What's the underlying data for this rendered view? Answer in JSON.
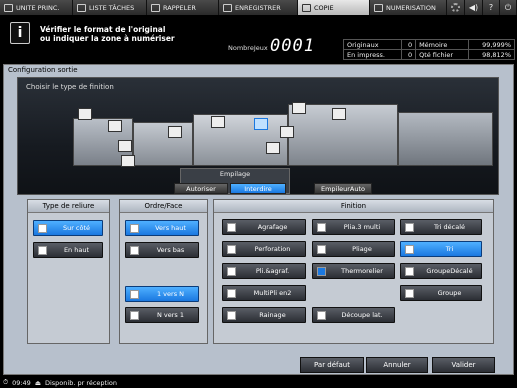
{
  "tabs": [
    {
      "label": "UNITE PRINC.",
      "icon": "home-icon"
    },
    {
      "label": "LISTE TÂCHES",
      "icon": "job-list-icon"
    },
    {
      "label": "RAPPELER",
      "icon": "recall-icon"
    },
    {
      "label": "ENREGISTRER",
      "icon": "save-icon"
    },
    {
      "label": "COPIE",
      "icon": "copy-icon"
    },
    {
      "label": "NUMERISATION",
      "icon": "scan-icon"
    }
  ],
  "message": {
    "line1": "Vérifier le format de l'original",
    "line2": "ou indiquer la zone à numériser"
  },
  "count": {
    "label": "NombreJeux",
    "value": "0001"
  },
  "counters": [
    {
      "label": "Originaux",
      "value": "0",
      "label2": "Mémoire",
      "value2": "99,999%"
    },
    {
      "label": "En impress.",
      "value": "0",
      "label2": "Qté fichier",
      "value2": "98,812%"
    }
  ],
  "panel_title": "Configuration sortie",
  "finishing_prompt": "Choisir le type de finition",
  "stacking": {
    "title": "Empilage",
    "options": [
      "Autoriser",
      "Interdire"
    ],
    "selected": "Interdire",
    "stacker_auto": "EmpileurAuto"
  },
  "binding": {
    "title": "Type de reliure",
    "options": [
      "Sur côté",
      "En haut"
    ],
    "selected": "Sur côté"
  },
  "order": {
    "title": "Ordre/Face",
    "face": [
      "Vers haut",
      "Vers bas"
    ],
    "selected_face": "Vers haut",
    "sequence": [
      "1 vers N",
      "N vers 1"
    ],
    "selected_sequence": "1 vers N"
  },
  "finishing": {
    "title": "Finition",
    "buttons": [
      "Agrafage",
      "Plia.3 multi",
      "Tri décalé",
      "Perforation",
      "Pliage",
      "Tri",
      "Pli.&agraf.",
      "Thermorelier",
      "GroupeDécalé",
      "MultiPli en2",
      "Groupe",
      "Rainage",
      "Découpe lat."
    ],
    "selected": "Tri"
  },
  "footer": {
    "default": "Par défaut",
    "cancel": "Annuler",
    "ok": "Valider"
  },
  "status": {
    "time": "09:49",
    "text": "Disponib. pr réception"
  }
}
